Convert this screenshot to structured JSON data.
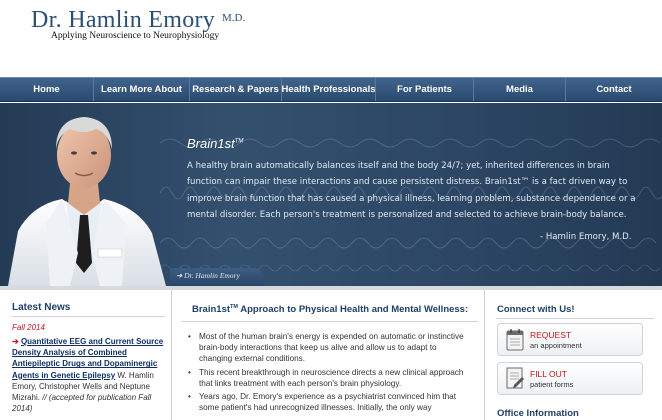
{
  "header": {
    "name": "Dr. Hamlin Emory",
    "credential": "M.D.",
    "tagline": "Applying Neuroscience to Neurophysiology"
  },
  "nav": [
    "Home",
    "Learn More About",
    "Research & Papers",
    "Health Professionals",
    "For Patients",
    "Media",
    "Contact"
  ],
  "hero": {
    "title": "Brain1st",
    "title_mark": "TM",
    "body": "A healthy brain automatically balances itself and the body 24/7; yet, inherited differences in brain function can impair these interactions and cause persistent distress. Brain1st™ is a fact driven way to improve brain function that has caused a physical illness, learning problem, substance dependence or a mental disorder. Each person's treatment is personalized and selected to achieve brain-body balance.",
    "signature": "- Hamlin Emory, M.D.",
    "portrait_caption": "Dr. Hamlin Emory"
  },
  "news": {
    "heading": "Latest News",
    "season": "Fall 2014",
    "item_title": "Quantitative EEG and Current Source Density Analysis of Combined Antiepileptic Drugs and Dopaminergic Agents in Genetic Epilepsy",
    "item_authors": "W. Hamlin Emory, Christopher Wells and Neptune Mizrahi.",
    "item_note": "// (accepted for publication Fall 2014)"
  },
  "center": {
    "title_prefix": "Brain1st",
    "title_mark": "TM",
    "title_suffix": " Approach to Physical Health and Mental Wellness:",
    "bullets": [
      "Most of the human brain's energy is expended on automatic or instinctive brain-body interactions that keep us alive and allow us to adapt to changing external conditions.",
      "This recent breakthrough in neuroscience directs a new clinical approach that links treatment with each person's brain physiology.",
      "Years ago, Dr. Emory's experience as a psychiatrist convinced him that some patient's had unrecognized illnesses. Initially, the only way"
    ]
  },
  "connect": {
    "heading": "Connect with Us!",
    "request_label": "REQUEST",
    "request_sub": "an appointment",
    "fillout_label": "FILL OUT",
    "fillout_sub": "patient forms",
    "office_heading": "Office Information"
  },
  "colors": {
    "brand_blue": "#2d4f74",
    "nav_blue": "#2a4a70",
    "accent_red": "#c0171c",
    "link_blue": "#0f2e63"
  }
}
